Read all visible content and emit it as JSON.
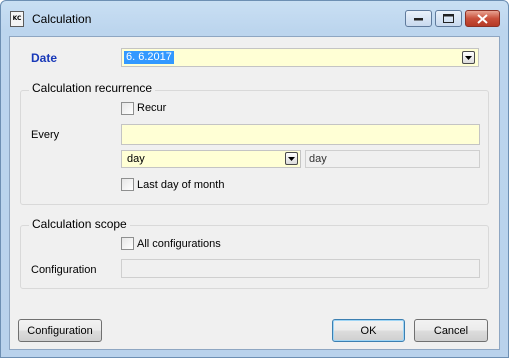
{
  "window": {
    "title": "Calculation",
    "app_icon_text": "KC"
  },
  "date": {
    "label": "Date",
    "value": "6. 6.2017"
  },
  "recurrence": {
    "group_title": "Calculation recurrence",
    "recur_label": "Recur",
    "recur_checked": false,
    "every_label": "Every",
    "every_value": "",
    "unit_value": "day",
    "unit_display": "day",
    "last_day_label": "Last day of month",
    "last_day_checked": false
  },
  "scope": {
    "group_title": "Calculation scope",
    "all_configs_label": "All configurations",
    "all_configs_checked": false,
    "configuration_label": "Configuration",
    "configuration_value": ""
  },
  "buttons": {
    "configuration": "Configuration",
    "ok": "OK",
    "cancel": "Cancel"
  },
  "icons": {
    "minimize": "minimize-icon",
    "maximize": "maximize-icon",
    "close": "close-icon",
    "dropdown": "chevron-down-icon"
  }
}
